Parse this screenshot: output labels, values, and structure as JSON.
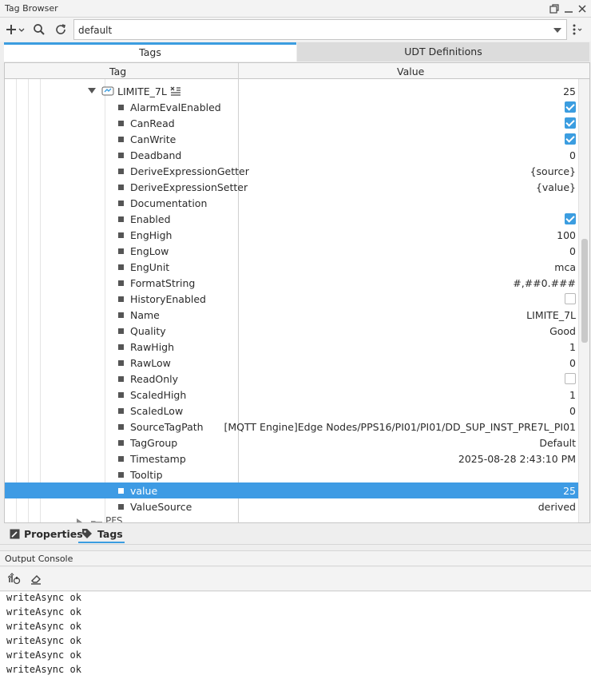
{
  "window": {
    "title": "Tag Browser"
  },
  "toolbar": {
    "provider_value": "default"
  },
  "tabs": [
    {
      "label": "Tags",
      "active": true
    },
    {
      "label": "UDT Definitions",
      "active": false
    }
  ],
  "table": {
    "headers": {
      "tag": "Tag",
      "value": "Value"
    },
    "parent": {
      "name": "LIMITE_7L",
      "value": "25"
    },
    "rows": [
      {
        "name": "AlarmEvalEnabled",
        "type": "checkbox",
        "checked": true
      },
      {
        "name": "CanRead",
        "type": "checkbox",
        "checked": true
      },
      {
        "name": "CanWrite",
        "type": "checkbox",
        "checked": true
      },
      {
        "name": "Deadband",
        "type": "text",
        "value": "0"
      },
      {
        "name": "DeriveExpressionGetter",
        "type": "text",
        "value": "{source}"
      },
      {
        "name": "DeriveExpressionSetter",
        "type": "text",
        "value": "{value}"
      },
      {
        "name": "Documentation",
        "type": "text",
        "value": ""
      },
      {
        "name": "Enabled",
        "type": "checkbox",
        "checked": true
      },
      {
        "name": "EngHigh",
        "type": "text",
        "value": "100"
      },
      {
        "name": "EngLow",
        "type": "text",
        "value": "0"
      },
      {
        "name": "EngUnit",
        "type": "text",
        "value": "mca"
      },
      {
        "name": "FormatString",
        "type": "text",
        "value": "#,##0.###"
      },
      {
        "name": "HistoryEnabled",
        "type": "checkbox",
        "checked": false
      },
      {
        "name": "Name",
        "type": "text",
        "value": "LIMITE_7L"
      },
      {
        "name": "Quality",
        "type": "text",
        "value": "Good"
      },
      {
        "name": "RawHigh",
        "type": "text",
        "value": "1"
      },
      {
        "name": "RawLow",
        "type": "text",
        "value": "0"
      },
      {
        "name": "ReadOnly",
        "type": "checkbox",
        "checked": false
      },
      {
        "name": "ScaledHigh",
        "type": "text",
        "value": "1"
      },
      {
        "name": "ScaledLow",
        "type": "text",
        "value": "0"
      },
      {
        "name": "SourceTagPath",
        "type": "text",
        "value": "[MQTT Engine]Edge Nodes/PPS16/PI01/PI01/DD_SUP_INST_PRE7L_PI01"
      },
      {
        "name": "TagGroup",
        "type": "text",
        "value": "Default"
      },
      {
        "name": "Timestamp",
        "type": "text",
        "value": "2025-08-28 2:43:10 PM"
      },
      {
        "name": "Tooltip",
        "type": "text",
        "value": ""
      },
      {
        "name": "value",
        "type": "text",
        "value": "25",
        "selected": true
      },
      {
        "name": "ValueSource",
        "type": "text",
        "value": "derived"
      }
    ],
    "partial_next": {
      "name": "PFS"
    }
  },
  "bottom_tabs": [
    {
      "label": "Properties",
      "active": false
    },
    {
      "label": "Tags",
      "active": true
    }
  ],
  "console": {
    "title": "Output Console",
    "lines": [
      "writeAsync ok",
      "writeAsync ok",
      "writeAsync ok",
      "writeAsync ok",
      "writeAsync ok",
      "writeAsync ok"
    ]
  },
  "colors": {
    "accent": "#3b9de0",
    "selection": "#3e9be4"
  }
}
